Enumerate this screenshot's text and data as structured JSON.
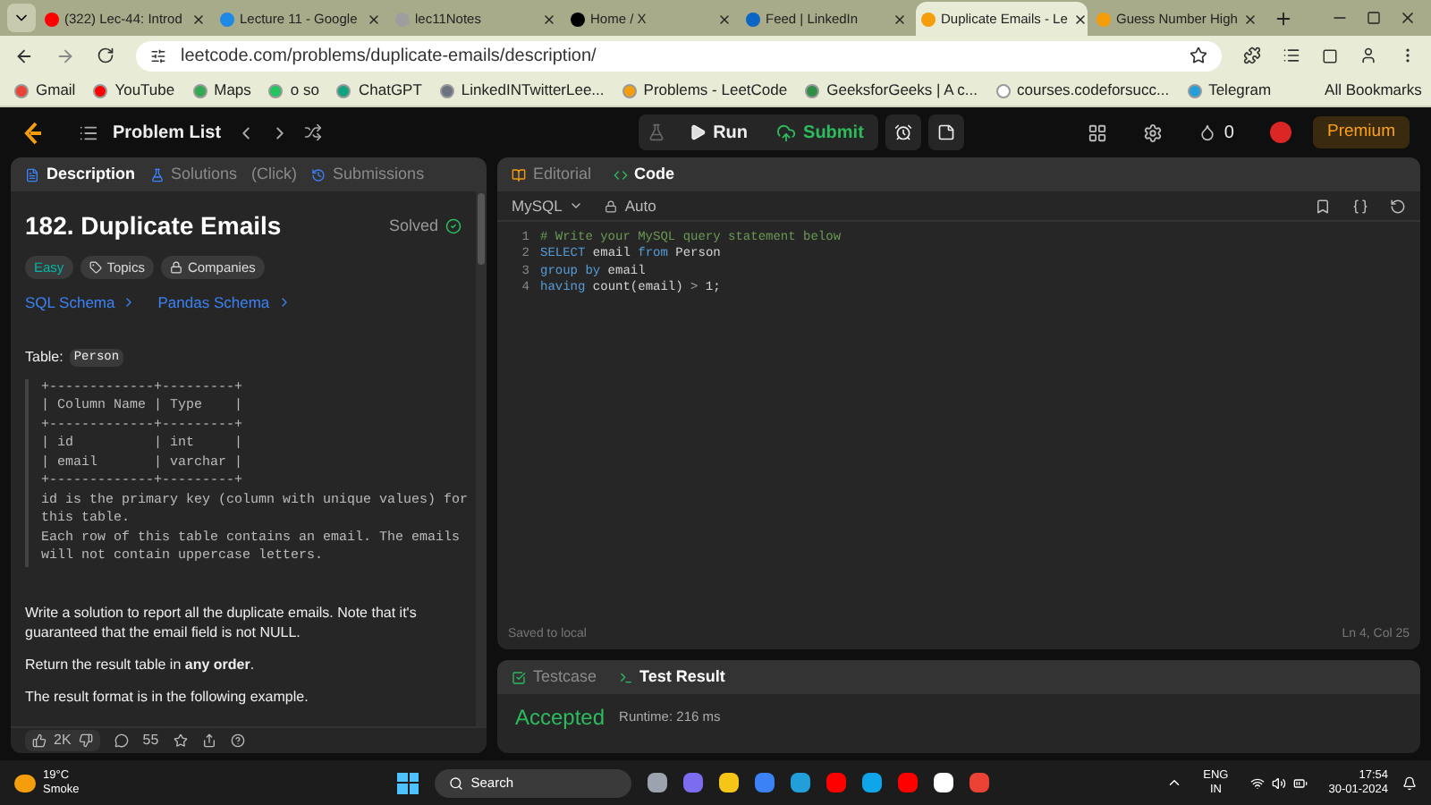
{
  "browser": {
    "tabs": [
      {
        "title": "(322) Lec-44: Introd",
        "color": "#ff0000",
        "selected": false
      },
      {
        "title": "Lecture 11 - Google",
        "color": "#1e88e5",
        "selected": false
      },
      {
        "title": "lec11Notes",
        "color": "#9e9e9e",
        "selected": false
      },
      {
        "title": "Home / X",
        "color": "#000000",
        "selected": false
      },
      {
        "title": "Feed | LinkedIn",
        "color": "#0a66c2",
        "selected": false
      },
      {
        "title": "Duplicate Emails - Le",
        "color": "#f59e0b",
        "selected": true
      },
      {
        "title": "Guess Number High",
        "color": "#f59e0b",
        "selected": false
      }
    ],
    "address": "leetcode.com/problems/duplicate-emails/description/",
    "bookmarks": [
      {
        "label": "Gmail",
        "color": "#ea4335"
      },
      {
        "label": "YouTube",
        "color": "#ff0000"
      },
      {
        "label": "Maps",
        "color": "#34a853"
      },
      {
        "label": "o so",
        "color": "#22c55e"
      },
      {
        "label": "ChatGPT",
        "color": "#10a37f"
      },
      {
        "label": "LinkedINTwitterLee...",
        "color": "#6b7280"
      },
      {
        "label": "Problems - LeetCode",
        "color": "#f59e0b"
      },
      {
        "label": "GeeksforGeeks | A c...",
        "color": "#2f8d46"
      },
      {
        "label": "courses.codeforsucc...",
        "color": "#ffffff"
      },
      {
        "label": "Telegram",
        "color": "#229ed9"
      }
    ],
    "all_bookmarks": "All Bookmarks"
  },
  "navbar": {
    "problem_list": "Problem List",
    "run": "Run",
    "submit": "Submit",
    "streak": "0",
    "premium": "Premium"
  },
  "description": {
    "tabs": [
      {
        "label": "Description",
        "selected": true
      },
      {
        "label": "Solutions",
        "selected": false
      },
      {
        "label": "(Click)",
        "selected": false
      },
      {
        "label": "Submissions",
        "selected": false
      }
    ],
    "title": "182. Duplicate Emails",
    "status": "Solved",
    "tags": [
      "Easy",
      "Topics",
      "Companies"
    ],
    "schemas": [
      "SQL Schema",
      "Pandas Schema"
    ],
    "table_label": "Table:",
    "table_name": "Person",
    "schema_block": [
      "+-------------+---------+",
      "| Column Name | Type    |",
      "+-------------+---------+",
      "| id          | int     |",
      "| email       | varchar |",
      "+-------------+---------+",
      "id is the primary key (column with unique values) for",
      "this table.",
      "Each row of this table contains an email. The emails",
      "will not contain uppercase letters."
    ],
    "paragraphs": [
      "Write a solution to report all the duplicate emails. Note that it's guaranteed that the email field is not NULL.",
      "Return the result table in **any order**.",
      "The result format is in the following example."
    ],
    "likes": "2K",
    "comments": "55"
  },
  "editor": {
    "tabs": [
      {
        "label": "Editorial",
        "selected": false
      },
      {
        "label": "Code",
        "selected": true
      }
    ],
    "language": "MySQL",
    "mode": "Auto",
    "lines": [
      {
        "number": "1",
        "tokens": [
          {
            "text": "# Write your MySQL query statement below",
            "kind": "comment"
          }
        ]
      },
      {
        "number": "2",
        "tokens": [
          {
            "text": "SELECT",
            "kind": "keyword"
          },
          {
            "text": " email ",
            "kind": "plain"
          },
          {
            "text": "from",
            "kind": "keyword"
          },
          {
            "text": " Person",
            "kind": "plain"
          }
        ]
      },
      {
        "number": "3",
        "tokens": [
          {
            "text": "group by",
            "kind": "keyword"
          },
          {
            "text": " email",
            "kind": "plain"
          }
        ]
      },
      {
        "number": "4",
        "tokens": [
          {
            "text": "having",
            "kind": "keyword"
          },
          {
            "text": " count(email) ",
            "kind": "plain"
          },
          {
            "text": ">",
            "kind": "operator"
          },
          {
            "text": " 1;",
            "kind": "plain"
          }
        ]
      }
    ],
    "saved": "Saved to local",
    "cursor": "Ln 4, Col 25"
  },
  "result": {
    "tabs": [
      {
        "label": "Testcase",
        "selected": false
      },
      {
        "label": "Test Result",
        "selected": true
      }
    ],
    "verdict": "Accepted",
    "runtime": "Runtime: 216 ms"
  },
  "taskbar": {
    "temperature": "19°C",
    "weather": "Smoke",
    "search": "Search",
    "language": "ENG",
    "region": "IN",
    "time": "17:54",
    "date": "30-01-2024"
  }
}
